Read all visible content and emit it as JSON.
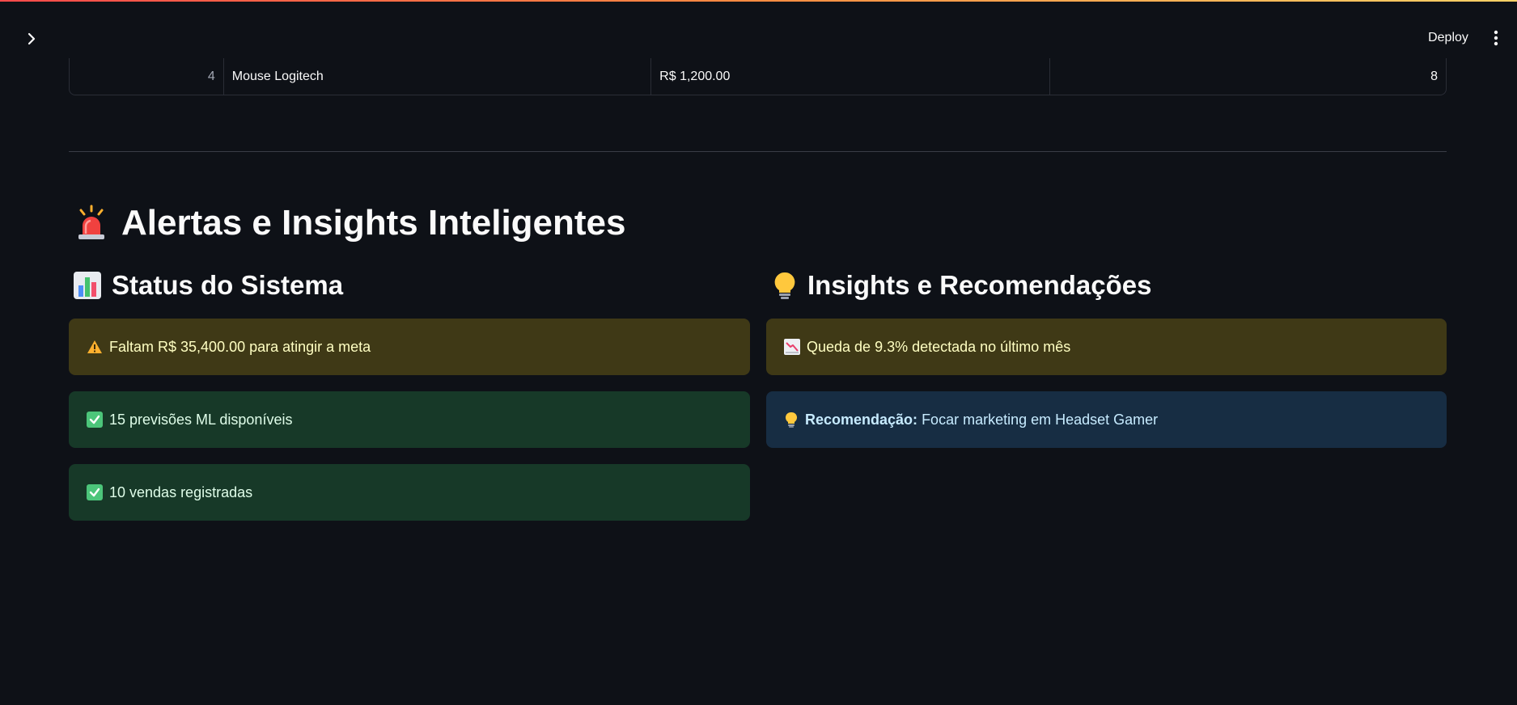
{
  "header": {
    "deploy_label": "Deploy"
  },
  "table": {
    "row": {
      "index": "4",
      "product": "Mouse Logitech",
      "price": "R$ 1,200.00",
      "quantity": "8"
    }
  },
  "main": {
    "title": "Alertas e Insights Inteligentes",
    "title_icon": "siren-icon"
  },
  "status": {
    "title": "Status do Sistema",
    "title_icon": "bar-chart-icon",
    "alerts": [
      {
        "type": "warning",
        "icon": "warning-icon",
        "text": "Faltam R$ 35,400.00 para atingir a meta"
      },
      {
        "type": "success",
        "icon": "check-icon",
        "text": "15 previsões ML disponíveis"
      },
      {
        "type": "success",
        "icon": "check-icon",
        "text": "10 vendas registradas"
      }
    ]
  },
  "insights": {
    "title": "Insights e Recomendações",
    "title_icon": "lightbulb-icon",
    "alerts": [
      {
        "type": "warning",
        "icon": "chart-decreasing-icon",
        "text": "Queda de 9.3% detectada no último mês"
      },
      {
        "type": "info",
        "icon": "lightbulb-icon",
        "label": "Recomendação:",
        "text": "Focar marketing em Headset Gamer"
      }
    ]
  },
  "colors": {
    "background": "#0e1117",
    "warning_bg": "#3f3916",
    "success_bg": "#173928",
    "info_bg": "#172d43",
    "accent": "#ff4b4b"
  }
}
